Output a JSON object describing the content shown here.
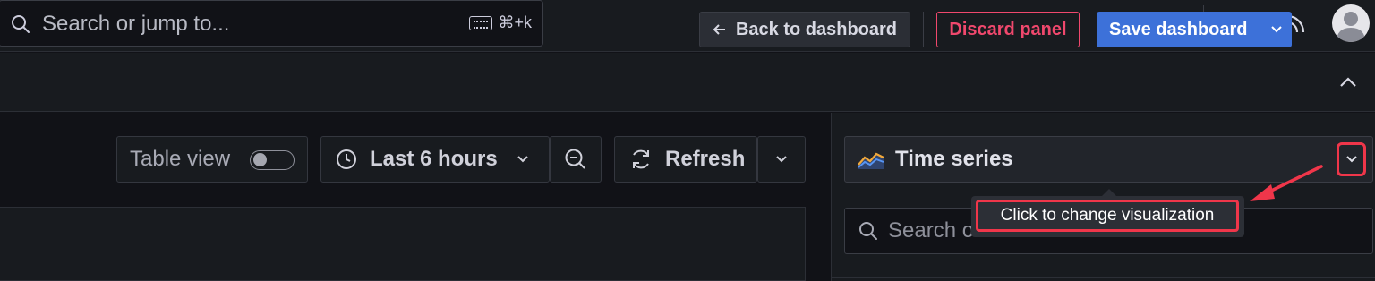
{
  "topbar": {
    "search_placeholder": "Search or jump to...",
    "shortcut": "⌘+k",
    "icons": [
      "search-icon",
      "keyboard-icon",
      "plus-icon",
      "chevron-down-icon",
      "help-icon",
      "rss-icon",
      "avatar"
    ]
  },
  "toolbar": {
    "back_label": "Back to dashboard",
    "discard_label": "Discard panel",
    "save_label": "Save dashboard"
  },
  "controls": {
    "table_view_label": "Table view",
    "table_view_on": false,
    "time_range_label": "Last 6 hours",
    "refresh_label": "Refresh"
  },
  "options_pane": {
    "visualization_label": "Time series",
    "search_options_placeholder": "Search o"
  },
  "annotation": {
    "tooltip_text": "Click to change visualization",
    "highlight_color": "#f0364a"
  },
  "colors": {
    "background": "#111217",
    "panel": "#181b1f",
    "primary": "#3d71d9",
    "destructive": "#f0486d"
  }
}
